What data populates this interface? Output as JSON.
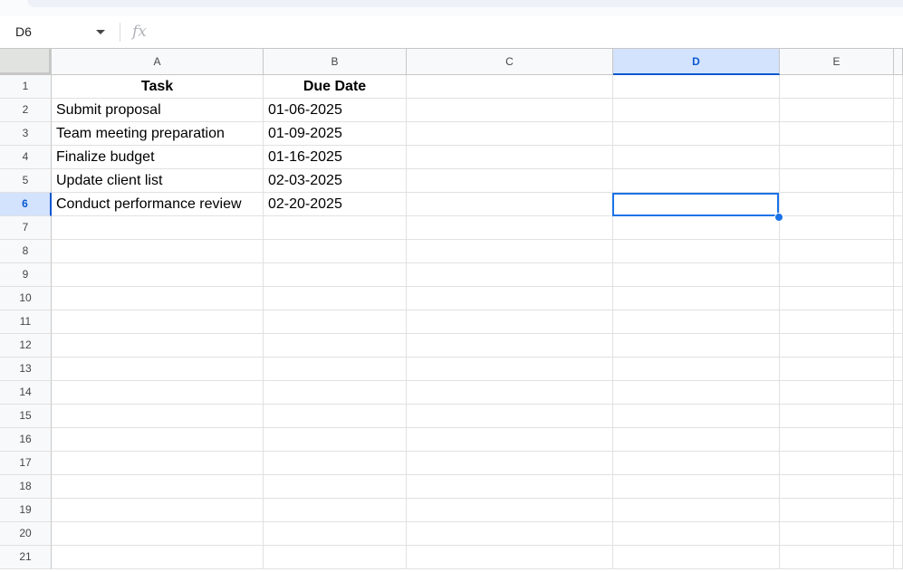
{
  "name_box": {
    "value": "D6"
  },
  "formula_bar": {
    "fx_label": "fx",
    "value": ""
  },
  "columns": [
    {
      "label": "A",
      "selected": false
    },
    {
      "label": "B",
      "selected": false
    },
    {
      "label": "C",
      "selected": false
    },
    {
      "label": "D",
      "selected": true
    },
    {
      "label": "E",
      "selected": false
    }
  ],
  "rows": [
    "1",
    "2",
    "3",
    "4",
    "5",
    "6",
    "7",
    "8",
    "9",
    "10",
    "11",
    "12",
    "13",
    "14",
    "15",
    "16",
    "17",
    "18",
    "19",
    "20",
    "21"
  ],
  "selected_cell": "D6",
  "sheet": {
    "headers": {
      "a": "Task",
      "b": "Due Date"
    },
    "tasks": [
      {
        "task": "Submit proposal",
        "due": "01-06-2025"
      },
      {
        "task": "Team meeting preparation",
        "due": "01-09-2025"
      },
      {
        "task": "Finalize budget",
        "due": "01-16-2025"
      },
      {
        "task": "Update client list",
        "due": "02-03-2025"
      },
      {
        "task": "Conduct performance review",
        "due": "02-20-2025"
      }
    ]
  },
  "colors": {
    "selection": "#1a73e8",
    "header_selected_bg": "#d3e3fd",
    "header_bg": "#f8f9fa"
  }
}
